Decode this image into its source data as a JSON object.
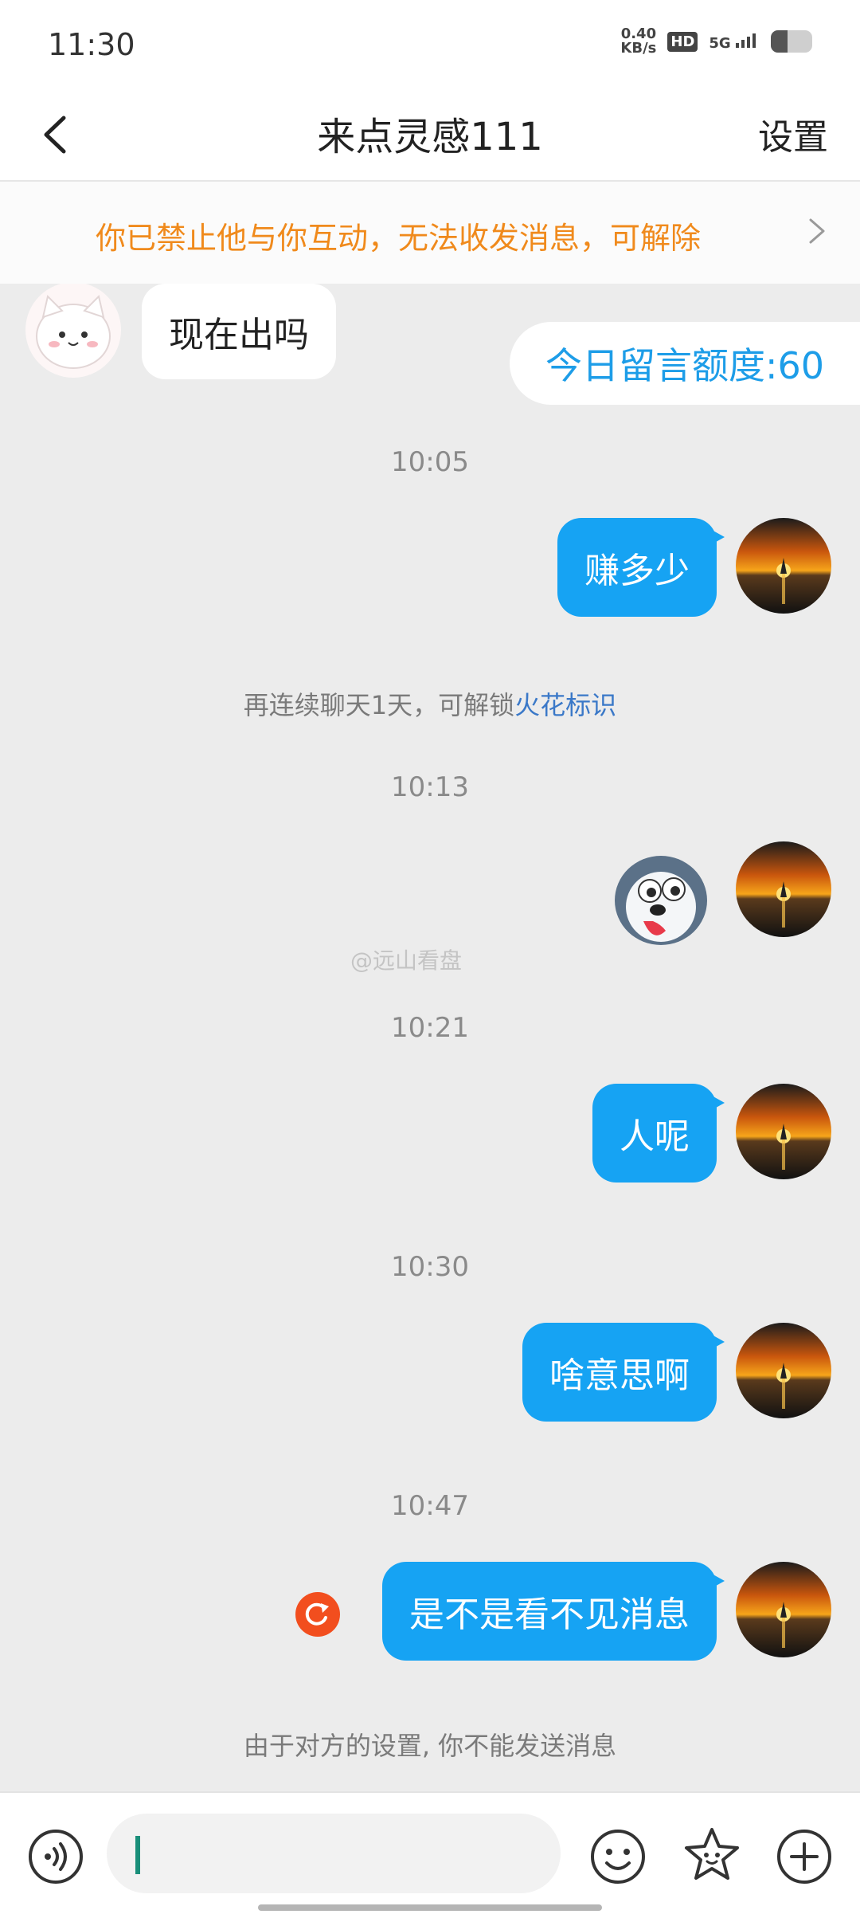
{
  "status_bar": {
    "time": "11:30",
    "net_speed_value": "0.40",
    "net_speed_unit": "KB/s",
    "hd_badge": "HD",
    "signal_label": "5G",
    "battery_level": 0.4
  },
  "header": {
    "back_icon": "chevron-left-icon",
    "title": "来点灵感111",
    "settings_label": "设置"
  },
  "banner": {
    "text": "你已禁止他与你互动，无法收发消息，可解除",
    "chevron_icon": "chevron-right-icon",
    "color": "#f08a1c"
  },
  "chat": {
    "quota_label": "今日留言额度:60",
    "messages": [
      {
        "side": "left",
        "text": "现在出吗"
      },
      {
        "time": "10:05"
      },
      {
        "side": "right",
        "text": "赚多少"
      },
      {
        "system_prefix": "再连续聊天1天，可解锁",
        "system_link": "火花标识"
      },
      {
        "time": "10:13"
      },
      {
        "side": "right",
        "sticker": "husky-sticker-icon"
      },
      {
        "time": "10:21"
      },
      {
        "side": "right",
        "text": "人呢"
      },
      {
        "time": "10:30"
      },
      {
        "side": "right",
        "text": "啥意思啊"
      },
      {
        "time": "10:47"
      },
      {
        "side": "right",
        "text": "是不是看不见消息",
        "status": "retry-icon"
      },
      {
        "system": "由于对方的设置, 你不能发送消息"
      }
    ],
    "watermark": "@远山看盘",
    "accent_color": "#16a3f3"
  },
  "input_bar": {
    "voice_icon": "voice-icon",
    "emoji_icon": "emoji-icon",
    "star_icon": "star-sticker-icon",
    "plus_icon": "plus-icon"
  }
}
